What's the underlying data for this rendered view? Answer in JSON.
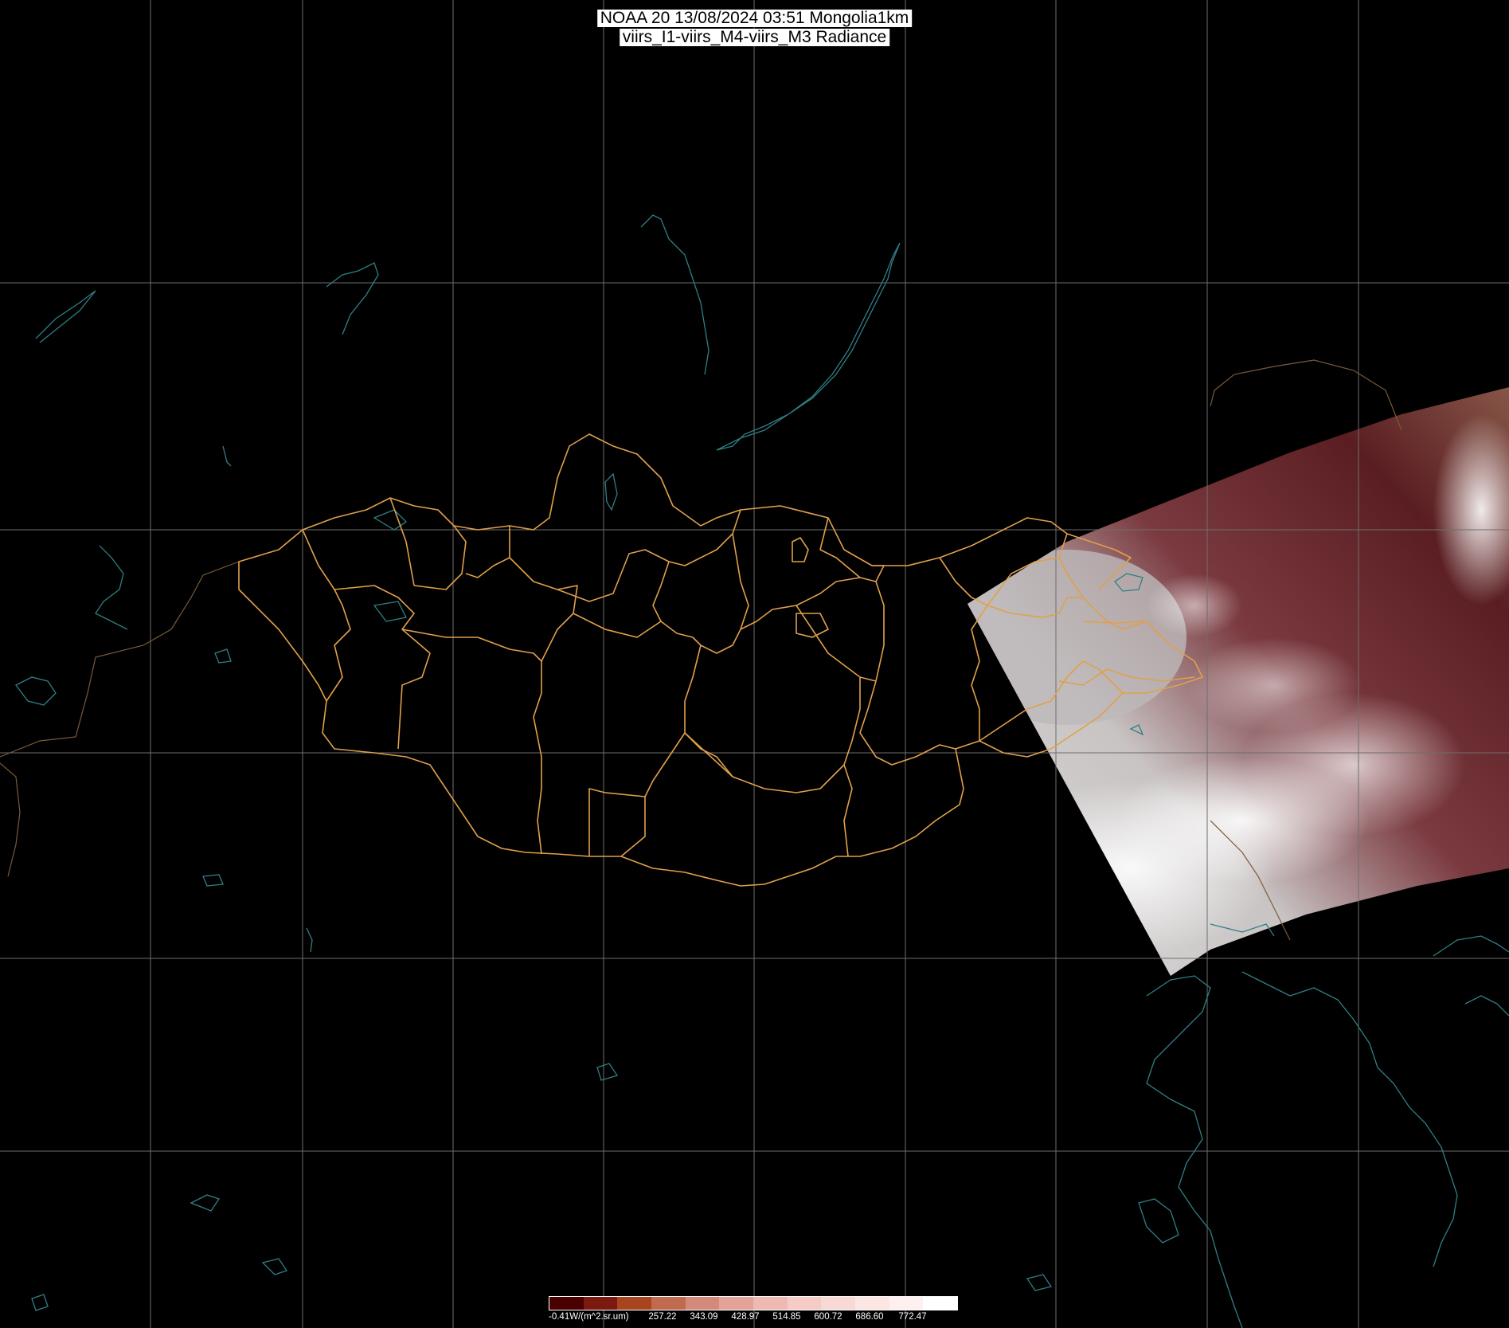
{
  "title": {
    "line1": "NOAA 20 13/08/2024 03:51 Mongolia1km",
    "line2": "viirs_I1-viirs_M4-viirs_M3 Radiance"
  },
  "colors": {
    "background": "#000000",
    "graticule": "#6e6e6e",
    "coastline": "#2f7f86",
    "admin_borders": "#e0a04a",
    "country_borders": "#7a5a3a"
  },
  "legend": {
    "unit_label": "-0.41W/(m^2.sr.um)",
    "ticks": [
      "257.22",
      "343.09",
      "428.97",
      "514.85",
      "600.72",
      "686.60",
      "772.47"
    ],
    "swatches": [
      "#4a0000",
      "#7a1a10",
      "#a8451f",
      "#c06a50",
      "#d48a7a",
      "#e3a39a",
      "#eeb9b3",
      "#f5cbc6",
      "#f8d9d6",
      "#fbe6e3",
      "#fdf0ee",
      "#ffffff"
    ]
  }
}
